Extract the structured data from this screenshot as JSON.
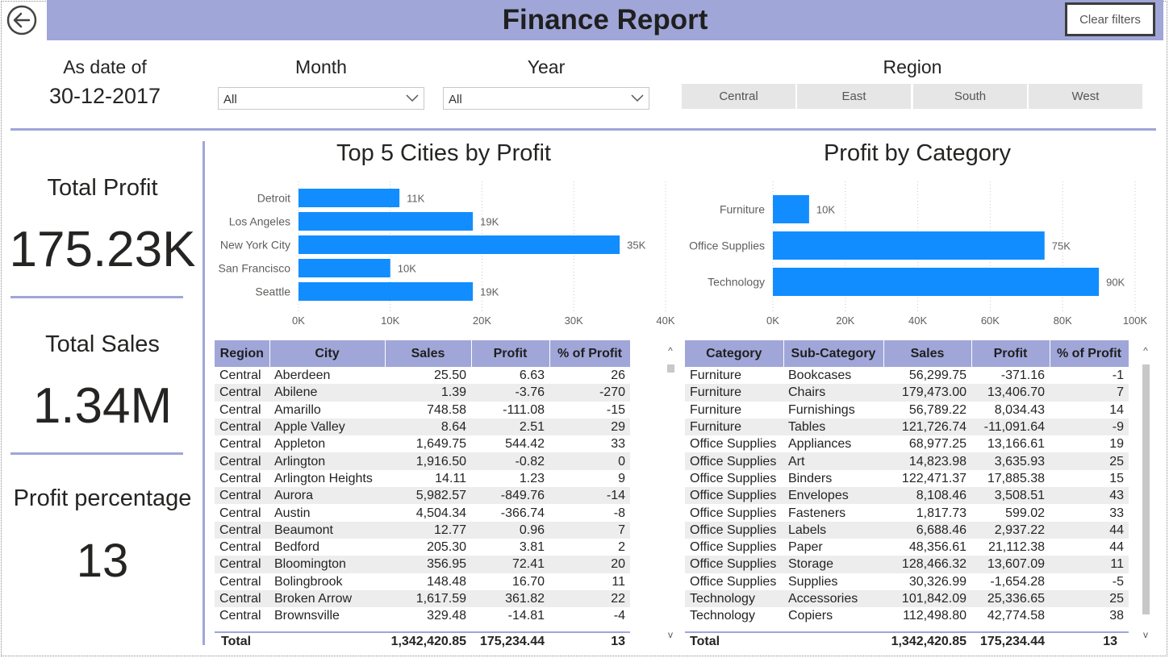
{
  "header": {
    "title": "Finance Report",
    "clear_filters": "Clear filters"
  },
  "filters": {
    "date_label": "As date of",
    "date_value": "30-12-2017",
    "month_label": "Month",
    "month_value": "All",
    "year_label": "Year",
    "year_value": "All",
    "region_label": "Region",
    "regions": [
      "Central",
      "East",
      "South",
      "West"
    ]
  },
  "kpis": {
    "total_profit_label": "Total Profit",
    "total_profit_value": "175.23K",
    "total_sales_label": "Total Sales",
    "total_sales_value": "1.34M",
    "profit_pct_label": "Profit percentage",
    "profit_pct_value": "13"
  },
  "chart_data": [
    {
      "type": "bar",
      "orientation": "horizontal",
      "title": "Top 5 Cities by Profit",
      "categories": [
        "Detroit",
        "Los Angeles",
        "New York City",
        "San Francisco",
        "Seattle"
      ],
      "values": [
        11000,
        19000,
        35000,
        10000,
        19000
      ],
      "data_labels": [
        "11K",
        "19K",
        "35K",
        "10K",
        "19K"
      ],
      "xlim": [
        0,
        40000
      ],
      "x_ticks": [
        "0K",
        "10K",
        "20K",
        "30K",
        "40K"
      ],
      "color": "#118dff",
      "grid": "vertical dotted"
    },
    {
      "type": "bar",
      "orientation": "horizontal",
      "title": "Profit by Category",
      "categories": [
        "Furniture",
        "Office Supplies",
        "Technology"
      ],
      "values": [
        10000,
        75000,
        90000
      ],
      "data_labels": [
        "10K",
        "75K",
        "90K"
      ],
      "xlim": [
        0,
        100000
      ],
      "x_ticks": [
        "0K",
        "20K",
        "40K",
        "60K",
        "80K",
        "100K"
      ],
      "color": "#118dff",
      "grid": "vertical dotted"
    }
  ],
  "city_table": {
    "columns": [
      "Region",
      "City",
      "Sales",
      "Profit",
      "% of Profit"
    ],
    "rows": [
      [
        "Central",
        "Aberdeen",
        "25.50",
        "6.63",
        "26"
      ],
      [
        "Central",
        "Abilene",
        "1.39",
        "-3.76",
        "-270"
      ],
      [
        "Central",
        "Amarillo",
        "748.58",
        "-111.08",
        "-15"
      ],
      [
        "Central",
        "Apple Valley",
        "8.64",
        "2.51",
        "29"
      ],
      [
        "Central",
        "Appleton",
        "1,649.75",
        "544.42",
        "33"
      ],
      [
        "Central",
        "Arlington",
        "1,916.50",
        "-0.82",
        "0"
      ],
      [
        "Central",
        "Arlington Heights",
        "14.11",
        "1.23",
        "9"
      ],
      [
        "Central",
        "Aurora",
        "5,982.57",
        "-849.76",
        "-14"
      ],
      [
        "Central",
        "Austin",
        "4,504.34",
        "-366.74",
        "-8"
      ],
      [
        "Central",
        "Beaumont",
        "12.77",
        "0.96",
        "7"
      ],
      [
        "Central",
        "Bedford",
        "205.30",
        "3.81",
        "2"
      ],
      [
        "Central",
        "Bloomington",
        "356.95",
        "72.41",
        "20"
      ],
      [
        "Central",
        "Bolingbrook",
        "148.48",
        "16.70",
        "11"
      ],
      [
        "Central",
        "Broken Arrow",
        "1,617.59",
        "361.82",
        "22"
      ],
      [
        "Central",
        "Brownsville",
        "329.48",
        "-14.81",
        "-4"
      ]
    ],
    "total": [
      "Total",
      "",
      "1,342,420.85",
      "175,234.44",
      "13"
    ]
  },
  "category_table": {
    "columns": [
      "Category",
      "Sub-Category",
      "Sales",
      "Profit",
      "% of Profit"
    ],
    "rows": [
      [
        "Furniture",
        "Bookcases",
        "56,299.75",
        "-371.16",
        "-1"
      ],
      [
        "Furniture",
        "Chairs",
        "179,473.00",
        "13,406.70",
        "7"
      ],
      [
        "Furniture",
        "Furnishings",
        "56,789.22",
        "8,034.43",
        "14"
      ],
      [
        "Furniture",
        "Tables",
        "121,726.74",
        "-11,091.64",
        "-9"
      ],
      [
        "Office Supplies",
        "Appliances",
        "68,977.25",
        "13,166.61",
        "19"
      ],
      [
        "Office Supplies",
        "Art",
        "14,823.98",
        "3,635.93",
        "25"
      ],
      [
        "Office Supplies",
        "Binders",
        "122,471.37",
        "17,885.38",
        "15"
      ],
      [
        "Office Supplies",
        "Envelopes",
        "8,108.46",
        "3,508.51",
        "43"
      ],
      [
        "Office Supplies",
        "Fasteners",
        "1,817.73",
        "599.02",
        "33"
      ],
      [
        "Office Supplies",
        "Labels",
        "6,688.46",
        "2,937.22",
        "44"
      ],
      [
        "Office Supplies",
        "Paper",
        "48,356.61",
        "21,112.38",
        "44"
      ],
      [
        "Office Supplies",
        "Storage",
        "128,466.32",
        "13,607.09",
        "11"
      ],
      [
        "Office Supplies",
        "Supplies",
        "30,326.99",
        "-1,654.28",
        "-5"
      ],
      [
        "Technology",
        "Accessories",
        "101,842.09",
        "25,336.65",
        "25"
      ],
      [
        "Technology",
        "Copiers",
        "112,498.80",
        "42,774.58",
        "38"
      ]
    ],
    "total": [
      "Total",
      "",
      "1,342,420.85",
      "175,234.44",
      "13"
    ]
  },
  "icons": {
    "back": "back-arrow-icon",
    "dropdown": "chevron-down-icon"
  }
}
